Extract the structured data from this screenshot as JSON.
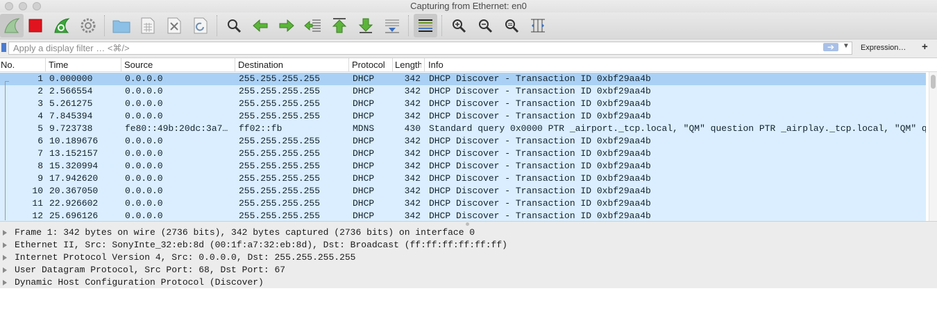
{
  "window": {
    "title": "Capturing from Ethernet: en0"
  },
  "toolbar": {
    "buttons": [
      {
        "name": "start-capture",
        "icon": "shark-fin-icon"
      },
      {
        "name": "stop-capture",
        "icon": "stop-square-icon"
      },
      {
        "name": "restart-capture",
        "icon": "restart-fin-icon"
      },
      {
        "name": "capture-options",
        "icon": "gear-icon"
      },
      {
        "name": "open-file",
        "icon": "folder-icon"
      },
      {
        "name": "save-file",
        "icon": "file-grid-icon"
      },
      {
        "name": "close-file",
        "icon": "file-close-icon"
      },
      {
        "name": "reload-file",
        "icon": "reload-icon"
      },
      {
        "name": "find-packet",
        "icon": "magnifier-icon"
      },
      {
        "name": "go-back",
        "icon": "arrow-left-icon"
      },
      {
        "name": "go-forward",
        "icon": "arrow-right-icon"
      },
      {
        "name": "go-to-packet",
        "icon": "jump-to-icon"
      },
      {
        "name": "first-packet",
        "icon": "arrow-top-icon"
      },
      {
        "name": "last-packet",
        "icon": "arrow-bottom-icon"
      },
      {
        "name": "auto-scroll",
        "icon": "autoscroll-icon"
      },
      {
        "name": "colorize",
        "icon": "colorize-lines-icon"
      },
      {
        "name": "zoom-in",
        "icon": "zoom-in-icon"
      },
      {
        "name": "zoom-out",
        "icon": "zoom-out-icon"
      },
      {
        "name": "normal-size",
        "icon": "zoom-normal-icon"
      },
      {
        "name": "resize-columns",
        "icon": "resize-columns-icon"
      }
    ]
  },
  "filter": {
    "placeholder": "Apply a display filter … <⌘/>",
    "expression_label": "Expression…",
    "add_label": "+"
  },
  "columns": [
    "No.",
    "Time",
    "Source",
    "Destination",
    "Protocol",
    "Length",
    "Info"
  ],
  "packets": [
    {
      "no": "1",
      "time": "0.000000",
      "src": "0.0.0.0",
      "dst": "255.255.255.255",
      "proto": "DHCP",
      "len": "342",
      "info": "DHCP Discover - Transaction ID 0xbf29aa4b",
      "selected": true
    },
    {
      "no": "2",
      "time": "2.566554",
      "src": "0.0.0.0",
      "dst": "255.255.255.255",
      "proto": "DHCP",
      "len": "342",
      "info": "DHCP Discover - Transaction ID 0xbf29aa4b"
    },
    {
      "no": "3",
      "time": "5.261275",
      "src": "0.0.0.0",
      "dst": "255.255.255.255",
      "proto": "DHCP",
      "len": "342",
      "info": "DHCP Discover - Transaction ID 0xbf29aa4b"
    },
    {
      "no": "4",
      "time": "7.845394",
      "src": "0.0.0.0",
      "dst": "255.255.255.255",
      "proto": "DHCP",
      "len": "342",
      "info": "DHCP Discover - Transaction ID 0xbf29aa4b"
    },
    {
      "no": "5",
      "time": "9.723738",
      "src": "fe80::49b:20dc:3a7…",
      "dst": "ff02::fb",
      "proto": "MDNS",
      "len": "430",
      "info": "Standard query 0x0000 PTR _airport._tcp.local, \"QM\" question PTR _airplay._tcp.local, \"QM\" q"
    },
    {
      "no": "6",
      "time": "10.189676",
      "src": "0.0.0.0",
      "dst": "255.255.255.255",
      "proto": "DHCP",
      "len": "342",
      "info": "DHCP Discover - Transaction ID 0xbf29aa4b"
    },
    {
      "no": "7",
      "time": "13.152157",
      "src": "0.0.0.0",
      "dst": "255.255.255.255",
      "proto": "DHCP",
      "len": "342",
      "info": "DHCP Discover - Transaction ID 0xbf29aa4b"
    },
    {
      "no": "8",
      "time": "15.320994",
      "src": "0.0.0.0",
      "dst": "255.255.255.255",
      "proto": "DHCP",
      "len": "342",
      "info": "DHCP Discover - Transaction ID 0xbf29aa4b"
    },
    {
      "no": "9",
      "time": "17.942620",
      "src": "0.0.0.0",
      "dst": "255.255.255.255",
      "proto": "DHCP",
      "len": "342",
      "info": "DHCP Discover - Transaction ID 0xbf29aa4b"
    },
    {
      "no": "10",
      "time": "20.367050",
      "src": "0.0.0.0",
      "dst": "255.255.255.255",
      "proto": "DHCP",
      "len": "342",
      "info": "DHCP Discover - Transaction ID 0xbf29aa4b"
    },
    {
      "no": "11",
      "time": "22.926602",
      "src": "0.0.0.0",
      "dst": "255.255.255.255",
      "proto": "DHCP",
      "len": "342",
      "info": "DHCP Discover - Transaction ID 0xbf29aa4b"
    },
    {
      "no": "12",
      "time": "25.696126",
      "src": "0.0.0.0",
      "dst": "255.255.255.255",
      "proto": "DHCP",
      "len": "342",
      "info": "DHCP Discover - Transaction ID 0xbf29aa4b"
    }
  ],
  "details": [
    "Frame 1: 342 bytes on wire (2736 bits), 342 bytes captured (2736 bits) on interface 0",
    "Ethernet II, Src: SonyInte_32:eb:8d (00:1f:a7:32:eb:8d), Dst: Broadcast (ff:ff:ff:ff:ff:ff)",
    "Internet Protocol Version 4, Src: 0.0.0.0, Dst: 255.255.255.255",
    "User Datagram Protocol, Src Port: 68, Dst Port: 67",
    "Dynamic Host Configuration Protocol (Discover)"
  ],
  "colors": {
    "selected_row": "#aad1f5",
    "udp_row": "#daeeff",
    "stop_red": "#e0141e",
    "shark_green": "#3aa83a",
    "arrow_green": "#4ca82a"
  }
}
